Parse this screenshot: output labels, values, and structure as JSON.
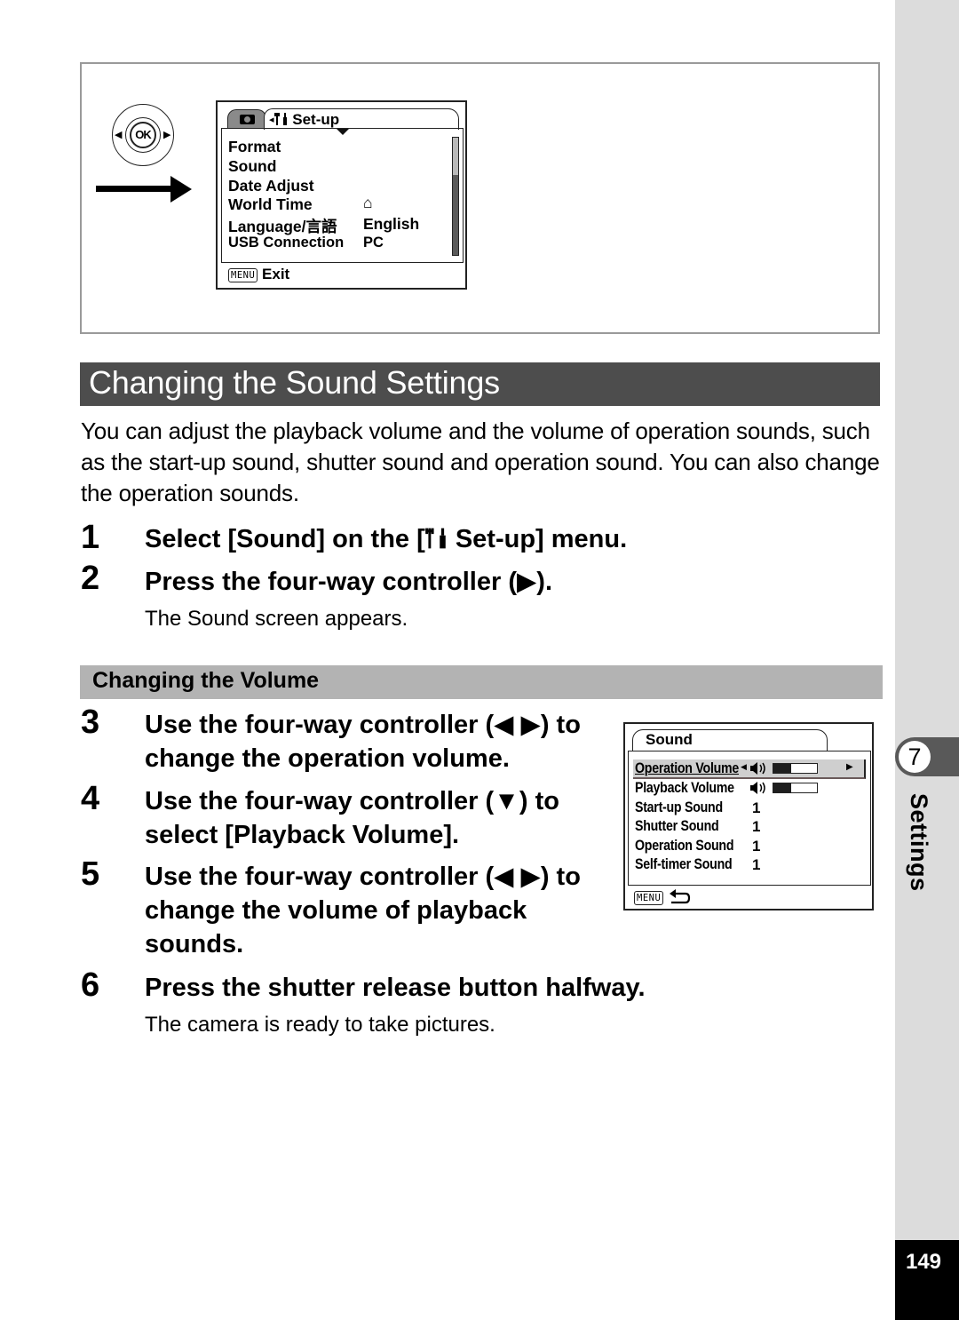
{
  "figure": {
    "controller": {
      "center_label": "OK",
      "left_glyph": "◀",
      "right_glyph": "▶"
    },
    "setup_screen": {
      "tab_camera_icon": "camera-icon",
      "tab_label": "◂🔧 Set-up",
      "tab_prefix_glyph": "◂",
      "tab_icon": "wrench-icon",
      "tab_text": "Set-up",
      "items": [
        {
          "label": "Format",
          "value": ""
        },
        {
          "label": "Sound",
          "value": ""
        },
        {
          "label": "Date Adjust",
          "value": ""
        },
        {
          "label": "World Time",
          "value": "⌂"
        },
        {
          "label": "Language/言語",
          "value": "English"
        },
        {
          "label": "USB Connection",
          "value": "PC"
        }
      ],
      "footer_key": "MENU",
      "footer_label": "Exit"
    }
  },
  "section": {
    "title": "Changing the Sound Settings",
    "intro": "You can adjust the playback volume and the volume of operation sounds, such as the start-up sound, shutter sound and operation sound. You can also change the operation sounds."
  },
  "steps": [
    {
      "num": "1",
      "text_before": "Select [Sound] on the [",
      "icon": "wrench-icon",
      "text_after": " Set-up] menu."
    },
    {
      "num": "2",
      "text": "Press the four-way controller (▶).",
      "sub": "The Sound screen appears."
    },
    {
      "num": "3",
      "text": "Use the four-way controller (◀ ▶) to change the operation volume."
    },
    {
      "num": "4",
      "text": "Use the four-way controller (▼) to select [Playback Volume]."
    },
    {
      "num": "5",
      "text": "Use the four-way controller (◀ ▶) to change the volume of playback sounds."
    },
    {
      "num": "6",
      "text": "Press the shutter release button halfway.",
      "sub": "The camera is ready to take pictures."
    }
  ],
  "subsection": {
    "title": "Changing the Volume"
  },
  "sound_screen": {
    "tab_label": "Sound",
    "items": [
      {
        "label": "Operation Volume",
        "value": "",
        "volume_fraction": 0.4,
        "selected": true
      },
      {
        "label": "Playback Volume",
        "value": "",
        "volume_fraction": 0.4,
        "selected": false
      },
      {
        "label": "Start-up Sound",
        "value": "1"
      },
      {
        "label": "Shutter Sound",
        "value": "1"
      },
      {
        "label": "Operation Sound",
        "value": "1"
      },
      {
        "label": "Self-timer Sound",
        "value": "1"
      }
    ],
    "left_arrow": "◀",
    "right_arrow": "▶",
    "footer_key": "MENU",
    "footer_icon": "back-arrow-icon"
  },
  "side_tab": {
    "chapter_number": "7",
    "chapter_label": "Settings"
  },
  "page_number": "149"
}
